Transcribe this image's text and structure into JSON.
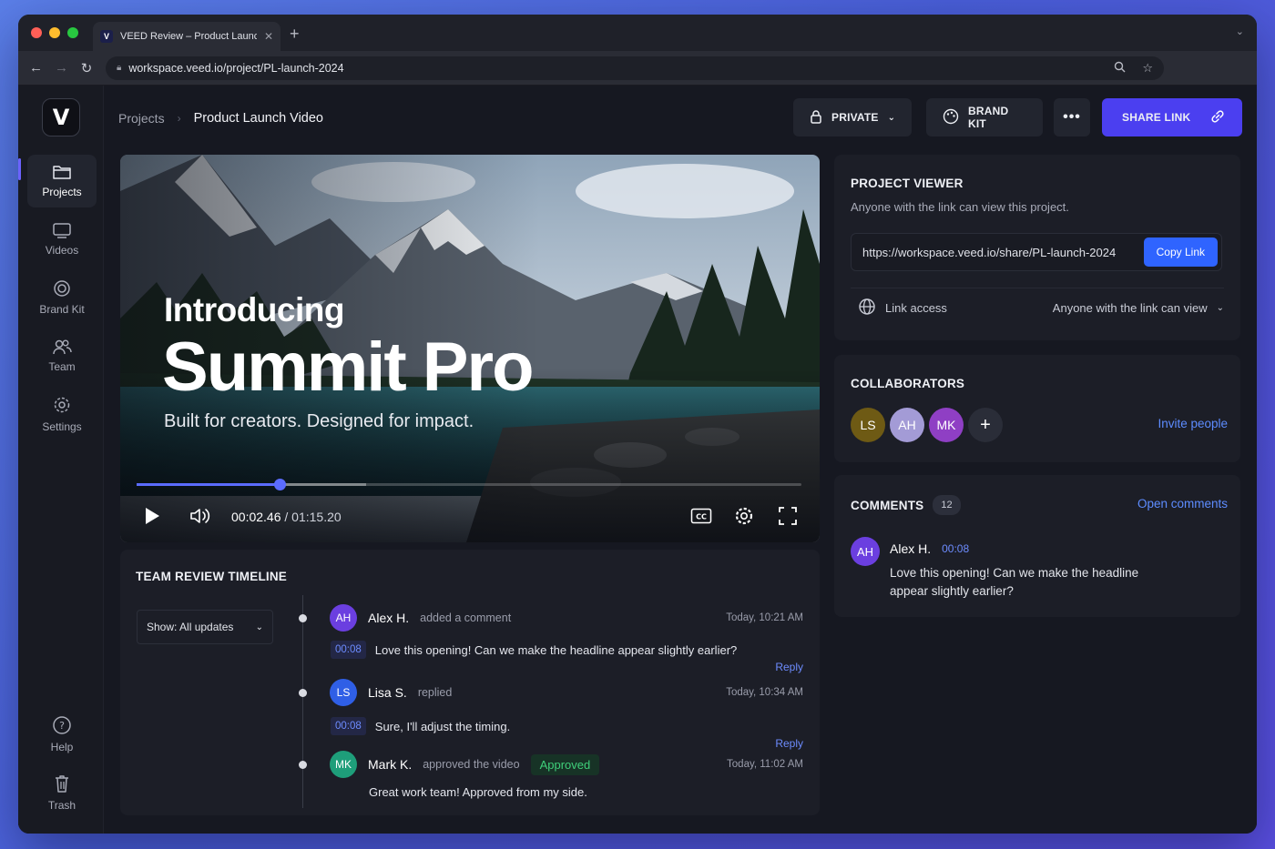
{
  "browser": {
    "tab_title": "VEED Review – Product Launch",
    "tab_logo": "V",
    "url": "workspace.veed.io/project/PL-launch-2024"
  },
  "app": {
    "logo": "V",
    "sidebar": {
      "items": [
        {
          "label": "Projects",
          "icon": "folder-icon",
          "active": true
        },
        {
          "label": "Videos",
          "icon": "monitor-icon"
        },
        {
          "label": "Brand Kit",
          "icon": "palette-icon"
        },
        {
          "label": "Team",
          "icon": "users-icon"
        },
        {
          "label": "Settings",
          "icon": "gear-icon"
        }
      ],
      "bottom": [
        {
          "label": "Help",
          "icon": "help-icon"
        },
        {
          "label": "Trash",
          "icon": "trash-icon"
        }
      ]
    },
    "breadcrumb": {
      "root": "Projects",
      "current": "Product Launch Video"
    },
    "toolbar": {
      "privacy_label": "PRIVATE",
      "brand_kit_label": "BRAND KIT",
      "share_label": "SHARE LINK"
    }
  },
  "video": {
    "headline_small": "Introducing",
    "headline_big": "Summit Pro",
    "tagline": "Built for creators. Designed for impact.",
    "current_time": "00:02.46",
    "separator": "/",
    "duration": "01:15.20",
    "progress_fraction": 0.215,
    "buffered_fraction": 0.345
  },
  "timeline": {
    "title": "TEAM REVIEW TIMELINE",
    "filter_label": "Show: All updates",
    "entries": [
      {
        "initials": "AH",
        "name": "Alex H.",
        "action": "added a comment",
        "time": "Today, 10:21 AM",
        "stamp": "00:08",
        "text": "Love this opening! Can we make the headline appear slightly earlier?",
        "reply": "Reply",
        "color": "#6b3fe0"
      },
      {
        "initials": "LS",
        "name": "Lisa S.",
        "action": "replied",
        "time": "Today, 10:34 AM",
        "stamp": "00:08",
        "text": "Sure, I'll adjust the timing.",
        "reply": "Reply",
        "color": "#2f5fe6"
      },
      {
        "initials": "MK",
        "name": "Mark K.",
        "action": "approved the video",
        "badge": "Approved",
        "time": "Today, 11:02 AM",
        "text": "Great work team! Approved from my side.",
        "color": "#1e9e7a"
      }
    ]
  },
  "viewer": {
    "title": "PROJECT VIEWER",
    "description": "Anyone with the link can view this project.",
    "link": "https://workspace.veed.io/share/PL-launch-2024",
    "copy_label": "Copy Link",
    "access_label": "Link access",
    "access_value": "Anyone with the link can view"
  },
  "collaborators": {
    "title": "COLLABORATORS",
    "people": [
      {
        "initials": "LS",
        "color": "#6e5a14"
      },
      {
        "initials": "AH",
        "color": "#a39bd6"
      },
      {
        "initials": "MK",
        "color": "#8f3fc4"
      }
    ],
    "add_label": "+",
    "invite_label": "Invite people"
  },
  "comments": {
    "title": "COMMENTS",
    "count": "12",
    "open_label": "Open comments",
    "latest": {
      "initials": "AH",
      "name": "Alex H.",
      "stamp": "00:08",
      "text": "Love this opening! Can we make the headline appear slightly earlier?"
    }
  }
}
